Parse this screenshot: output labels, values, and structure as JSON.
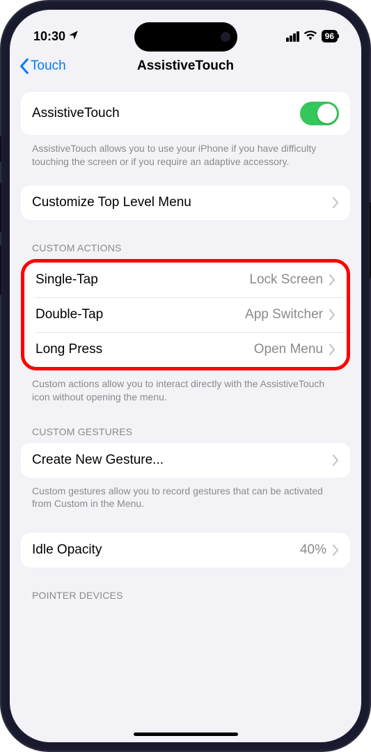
{
  "statusBar": {
    "time": "10:30",
    "batteryPct": "96"
  },
  "nav": {
    "back": "Touch",
    "title": "AssistiveTouch"
  },
  "sections": {
    "top": {
      "toggleLabel": "AssistiveTouch",
      "toggleOn": true,
      "footer": "AssistiveTouch allows you to use your iPhone if you have difficulty touching the screen or if you require an adaptive accessory.",
      "customizeLabel": "Customize Top Level Menu"
    },
    "customActions": {
      "header": "CUSTOM ACTIONS",
      "rows": [
        {
          "label": "Single-Tap",
          "value": "Lock Screen"
        },
        {
          "label": "Double-Tap",
          "value": "App Switcher"
        },
        {
          "label": "Long Press",
          "value": "Open Menu"
        }
      ],
      "footer": "Custom actions allow you to interact directly with the AssistiveTouch icon without opening the menu."
    },
    "customGestures": {
      "header": "CUSTOM GESTURES",
      "label": "Create New Gesture...",
      "footer": "Custom gestures allow you to record gestures that can be activated from Custom in the Menu."
    },
    "idleOpacity": {
      "label": "Idle Opacity",
      "value": "40%"
    },
    "pointerDevices": {
      "header": "POINTER DEVICES"
    }
  }
}
